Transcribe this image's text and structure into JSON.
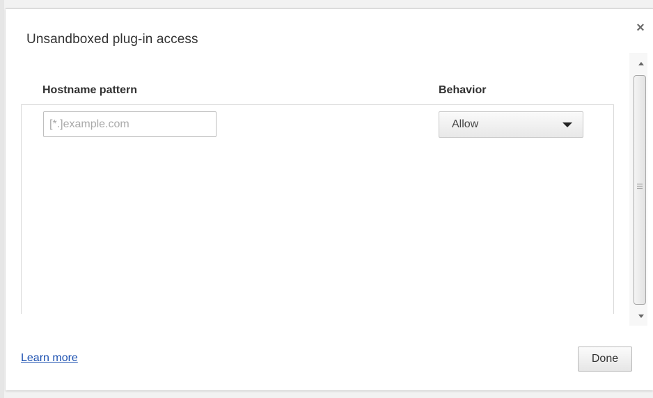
{
  "dialog": {
    "title": "Unsandboxed plug-in access",
    "close_glyph": "×"
  },
  "table": {
    "columns": [
      "Hostname pattern",
      "Behavior"
    ],
    "new_row": {
      "hostname_placeholder": "[*.]example.com",
      "hostname_value": "",
      "behavior_selected": "Allow"
    }
  },
  "footer": {
    "learn_more_label": "Learn more",
    "done_label": "Done"
  },
  "icons": {
    "close": "close-icon",
    "dropdown": "chevron-down-icon",
    "scroll_up": "scroll-up-icon",
    "scroll_down": "scroll-down-icon"
  },
  "colors": {
    "link": "#1a4fb0",
    "title": "#333333"
  }
}
